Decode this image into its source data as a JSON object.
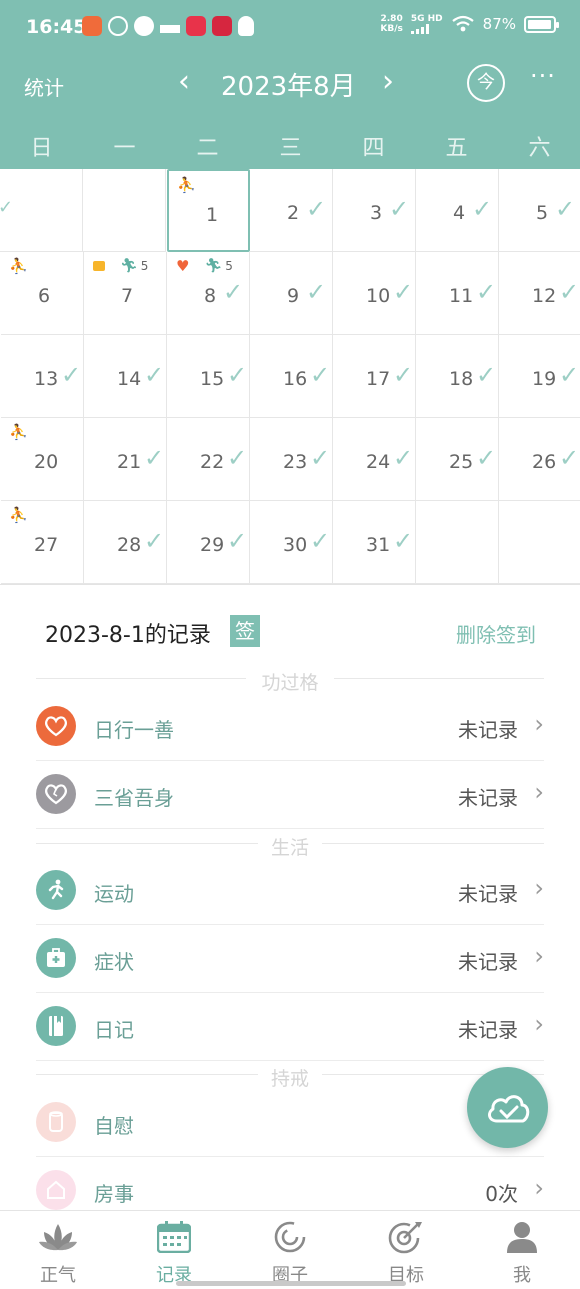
{
  "status_bar": {
    "time": "16:45",
    "net_speed_value": "2.80",
    "net_speed_unit": "KB/s",
    "network_type": "5G HD",
    "battery_percent": "87%",
    "battery_level": 0.87
  },
  "header": {
    "stats_label": "统计",
    "prev_label": "‹",
    "month_title": "2023年8月",
    "next_label": "›",
    "today_label": "今",
    "more_label": "···",
    "weekdays": [
      "日",
      "一",
      "二",
      "三",
      "四",
      "五",
      "六"
    ]
  },
  "calendar": {
    "selected_day": 1,
    "days": [
      {
        "day": "1",
        "checked": false,
        "marks": [
          "yoga"
        ]
      },
      {
        "day": "2",
        "checked": true,
        "marks": []
      },
      {
        "day": "3",
        "checked": true,
        "marks": []
      },
      {
        "day": "4",
        "checked": true,
        "marks": []
      },
      {
        "day": "5",
        "checked": true,
        "marks": []
      },
      {
        "day": "6",
        "checked": false,
        "marks": [
          "yoga"
        ]
      },
      {
        "day": "7",
        "checked": false,
        "marks": [
          "pc",
          "run"
        ],
        "count": "5"
      },
      {
        "day": "8",
        "checked": true,
        "marks": [
          "heart",
          "run"
        ],
        "count": "5"
      },
      {
        "day": "9",
        "checked": true,
        "marks": []
      },
      {
        "day": "10",
        "checked": true,
        "marks": []
      },
      {
        "day": "11",
        "checked": true,
        "marks": []
      },
      {
        "day": "12",
        "checked": true,
        "marks": []
      },
      {
        "day": "13",
        "checked": true,
        "marks": []
      },
      {
        "day": "14",
        "checked": true,
        "marks": []
      },
      {
        "day": "15",
        "checked": true,
        "marks": []
      },
      {
        "day": "16",
        "checked": true,
        "marks": []
      },
      {
        "day": "17",
        "checked": true,
        "marks": []
      },
      {
        "day": "18",
        "checked": true,
        "marks": []
      },
      {
        "day": "19",
        "checked": true,
        "marks": []
      },
      {
        "day": "20",
        "checked": false,
        "marks": [
          "yoga"
        ]
      },
      {
        "day": "21",
        "checked": true,
        "marks": []
      },
      {
        "day": "22",
        "checked": true,
        "marks": []
      },
      {
        "day": "23",
        "checked": true,
        "marks": []
      },
      {
        "day": "24",
        "checked": true,
        "marks": []
      },
      {
        "day": "25",
        "checked": true,
        "marks": []
      },
      {
        "day": "26",
        "checked": true,
        "marks": []
      },
      {
        "day": "27",
        "checked": false,
        "marks": [
          "yoga"
        ]
      },
      {
        "day": "28",
        "checked": true,
        "marks": []
      },
      {
        "day": "29",
        "checked": true,
        "marks": []
      },
      {
        "day": "30",
        "checked": true,
        "marks": []
      },
      {
        "day": "31",
        "checked": true,
        "marks": []
      }
    ]
  },
  "record": {
    "title": "2023-8-1的记录",
    "sign_badge": "签",
    "delete_checkin": "删除签到"
  },
  "sections": [
    {
      "title": "功过格"
    },
    {
      "title": "生活"
    },
    {
      "title": "持戒"
    }
  ],
  "rows": [
    {
      "label": "日行一善",
      "value": "未记录",
      "icon": "heart-icon",
      "color": "#ec6a3c"
    },
    {
      "label": "三省吾身",
      "value": "未记录",
      "icon": "heart-outline-icon",
      "color": "#9c9a9f"
    },
    {
      "label": "运动",
      "value": "未记录",
      "icon": "running-icon",
      "color": "#72b7a9"
    },
    {
      "label": "症状",
      "value": "未记录",
      "icon": "medical-kit-icon",
      "color": "#72b7a9"
    },
    {
      "label": "日记",
      "value": "未记录",
      "icon": "diary-icon",
      "color": "#72b7a9"
    },
    {
      "label": "自慰",
      "value": "",
      "icon": "cup-icon",
      "color": "#f9ddd9"
    },
    {
      "label": "房事",
      "value": "0次",
      "icon": "house-icon",
      "color": "#fbe0ea"
    }
  ],
  "nav": [
    {
      "label": "正气",
      "icon": "lotus-icon",
      "active": false
    },
    {
      "label": "记录",
      "icon": "calendar-icon",
      "active": true
    },
    {
      "label": "圈子",
      "icon": "circle-icon",
      "active": false
    },
    {
      "label": "目标",
      "icon": "target-icon",
      "active": false
    },
    {
      "label": "我",
      "icon": "person-icon",
      "active": false
    }
  ],
  "colors": {
    "brand": "#7fbfb2",
    "check": "#9dcfc5",
    "active_tab": "#6aaea1"
  }
}
